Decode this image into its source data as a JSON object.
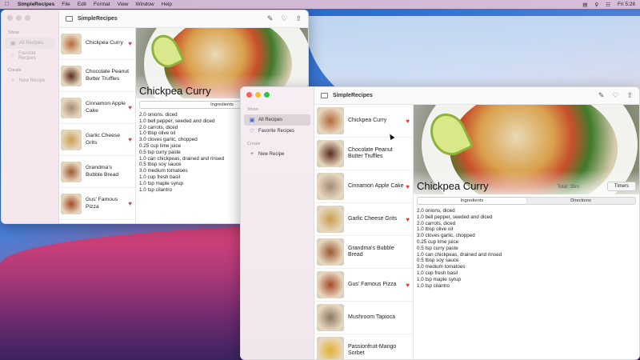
{
  "menubar": {
    "app": "SimpleRecipes",
    "menus": [
      "File",
      "Edit",
      "Format",
      "View",
      "Window",
      "Help"
    ],
    "clock": "Fri 5:28"
  },
  "window": {
    "title": "SimpleRecipes",
    "sidebar": {
      "section_show": "Show",
      "all_recipes": "All Recipes",
      "favorite_recipes": "Favorite Recipes",
      "section_create": "Create",
      "new_recipe": "New Recipe"
    },
    "recipes_win2": [
      {
        "name": "Chickpea Curry",
        "fav": true,
        "thumb": "#b46a3a"
      },
      {
        "name": "Chocolate Peanut Butter Truffles",
        "fav": false,
        "thumb": "#5a2a1e"
      },
      {
        "name": "Cinnamon Apple Cake",
        "fav": true,
        "thumb": "#a88a7a"
      },
      {
        "name": "Garlic Cheese Grits",
        "fav": true,
        "thumb": "#c9a050"
      },
      {
        "name": "Grandma's Bubble Bread",
        "fav": false,
        "thumb": "#9a5a32"
      },
      {
        "name": "Gus' Famous Pizza",
        "fav": true,
        "thumb": "#a54a2a"
      },
      {
        "name": "Mushroom Tapioca",
        "fav": false,
        "thumb": "#8a7a62"
      },
      {
        "name": "Passionfruit-Mango Sorbet",
        "fav": false,
        "thumb": "#e2b030"
      }
    ],
    "recipes_win1": [
      {
        "name": "Chickpea Curry",
        "fav": true,
        "thumb": "#b46a3a"
      },
      {
        "name": "Chocolate Peanut Butter Truffles",
        "fav": false,
        "thumb": "#5a2a1e"
      },
      {
        "name": "Cinnamon Apple Cake",
        "fav": true,
        "thumb": "#a88a7a"
      },
      {
        "name": "Garlic Cheese Grits",
        "fav": true,
        "thumb": "#c9a050"
      },
      {
        "name": "Grandma's Bubble Bread",
        "fav": false,
        "thumb": "#9a5a32"
      },
      {
        "name": "Gus' Famous Pizza",
        "fav": true,
        "thumb": "#a54a2a"
      },
      {
        "name": "Mushroom Tapioca",
        "fav": false,
        "thumb": "#8a7a62"
      },
      {
        "name": "Passionfruit-Mango Sorbet",
        "fav": false,
        "thumb": "#e2b030"
      }
    ],
    "detail": {
      "title": "Chickpea Curry",
      "total": "Total: 35m",
      "timers": "Timers",
      "tab_ingredients": "Ingredients",
      "tab_directions": "Directions",
      "win1_cut": "To",
      "ingredients": [
        "2.0  onions, diced",
        "1.0  bell pepper, seeded and diced",
        "2.0  carrots, diced",
        "1.0 tbsp olive oil",
        "3.0  cloves garlic, chopped",
        "0.25 cup lime juice",
        "0.5 tsp curry paste",
        "1.0  can chickpeas, drained and rinsed",
        "0.5 tbsp soy sauce",
        "3.0  medium tomatoes",
        "1.0 cup fresh basil",
        "1.0 tsp maple syrup",
        "1.0 tsp cilantro"
      ]
    }
  },
  "colors": {
    "accent": "#2f6bd5",
    "heart": "#e03b3b"
  }
}
